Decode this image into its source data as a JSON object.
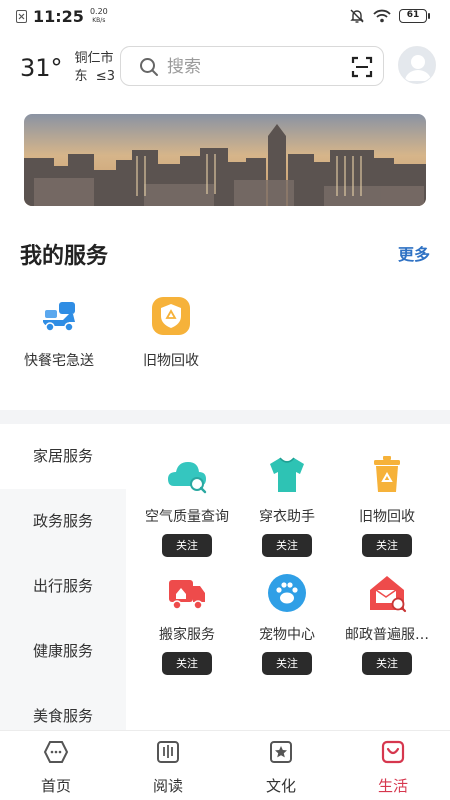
{
  "status_bar": {
    "time": "11:25",
    "speed_value": "0.20",
    "speed_unit": "KB/s",
    "battery": "61"
  },
  "header": {
    "temperature": "31°",
    "city": "铜仁市",
    "wind": "东  ≤3",
    "search_placeholder": "搜索"
  },
  "my_services": {
    "title": "我的服务",
    "more_label": "更多",
    "items": [
      {
        "label": "快餐宅急送",
        "icon": "delivery-scooter-icon",
        "color": "#2f8de4"
      },
      {
        "label": "旧物回收",
        "icon": "recycle-badge-icon",
        "color": "#f6b23a"
      }
    ]
  },
  "categories": [
    {
      "label": "家居服务"
    },
    {
      "label": "政务服务"
    },
    {
      "label": "出行服务"
    },
    {
      "label": "健康服务"
    },
    {
      "label": "美食服务"
    }
  ],
  "tiles": [
    {
      "label": "空气质量查询",
      "icon": "air-quality-icon",
      "color": "#35c6bf",
      "button": "关注"
    },
    {
      "label": "穿衣助手",
      "icon": "tshirt-icon",
      "color": "#2ec3b4",
      "button": "关注"
    },
    {
      "label": "旧物回收",
      "icon": "recycle-bin-icon",
      "color": "#f6b23a",
      "button": "关注"
    },
    {
      "label": "搬家服务",
      "icon": "moving-truck-icon",
      "color": "#ee4b4b",
      "button": "关注"
    },
    {
      "label": "宠物中心",
      "icon": "paw-icon",
      "color": "#2f9fe6",
      "button": "关注"
    },
    {
      "label": "邮政普遍服…",
      "icon": "postal-house-icon",
      "color": "#ee4b4b",
      "button": "关注"
    }
  ],
  "bottom_nav": [
    {
      "label": "首页",
      "icon": "home-icon"
    },
    {
      "label": "阅读",
      "icon": "book-icon"
    },
    {
      "label": "文化",
      "icon": "culture-star-icon"
    },
    {
      "label": "生活",
      "icon": "life-bag-icon",
      "active": true
    }
  ],
  "colors": {
    "accent": "#2f72c4",
    "active_tab": "#d6374e",
    "button_dark": "#2b2b2b"
  }
}
